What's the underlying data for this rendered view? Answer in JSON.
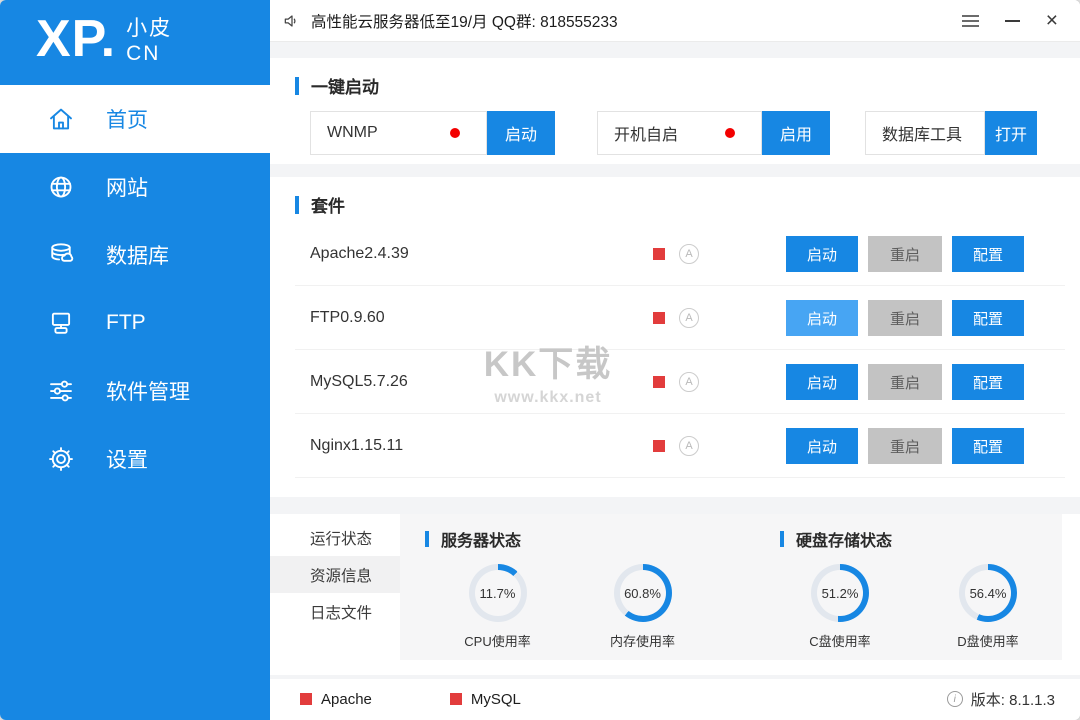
{
  "window": {
    "banner": "高性能云服务器低至19/月  QQ群: 818555233"
  },
  "sidebar": {
    "logo": {
      "main": "XP.",
      "sub_line1": "小皮",
      "sub_line2": "CN"
    },
    "items": [
      {
        "label": "首页",
        "icon": "home-icon",
        "active": true
      },
      {
        "label": "网站",
        "icon": "globe-icon",
        "active": false
      },
      {
        "label": "数据库",
        "icon": "database-icon",
        "active": false
      },
      {
        "label": "FTP",
        "icon": "ftp-icon",
        "active": false
      },
      {
        "label": "软件管理",
        "icon": "sliders-icon",
        "active": false
      },
      {
        "label": "设置",
        "icon": "gear-icon",
        "active": false
      }
    ]
  },
  "quick_start": {
    "title": "一键启动",
    "groups": [
      {
        "label": "WNMP",
        "button": "启动",
        "has_dot": true
      },
      {
        "label": "开机自启",
        "button": "启用",
        "has_dot": true
      },
      {
        "label": "数据库工具",
        "button": "打开",
        "has_dot": false
      }
    ]
  },
  "suite": {
    "title": "套件",
    "actions": {
      "start": "启动",
      "restart": "重启",
      "config": "配置"
    },
    "rows": [
      {
        "name": "Apache2.4.39"
      },
      {
        "name": "FTP0.9.60"
      },
      {
        "name": "MySQL5.7.26"
      },
      {
        "name": "Nginx1.15.11"
      }
    ],
    "status_letter": "A"
  },
  "status": {
    "tabs": [
      "运行状态",
      "资源信息",
      "日志文件"
    ],
    "active_tab": "资源信息",
    "server": {
      "title": "服务器状态",
      "gauges": [
        {
          "value": "11.7%",
          "pct": 11.7,
          "label": "CPU使用率"
        },
        {
          "value": "60.8%",
          "pct": 60.8,
          "label": "内存使用率"
        }
      ]
    },
    "disk": {
      "title": "硬盘存储状态",
      "gauges": [
        {
          "value": "51.2%",
          "pct": 51.2,
          "label": "C盘使用率"
        },
        {
          "value": "56.4%",
          "pct": 56.4,
          "label": "D盘使用率"
        }
      ]
    }
  },
  "footer": {
    "legend": [
      "Apache",
      "MySQL"
    ],
    "info_glyph": "i",
    "version": "版本: 8.1.1.3"
  },
  "watermark": {
    "title": "KK下载",
    "url": "www.kkx.net"
  },
  "colors": {
    "blue": "#1787e3",
    "blue_light": "#47a5f3",
    "track": "#e2e7ee",
    "red_square": "#e23c3c",
    "red_dot": "#f30000"
  }
}
